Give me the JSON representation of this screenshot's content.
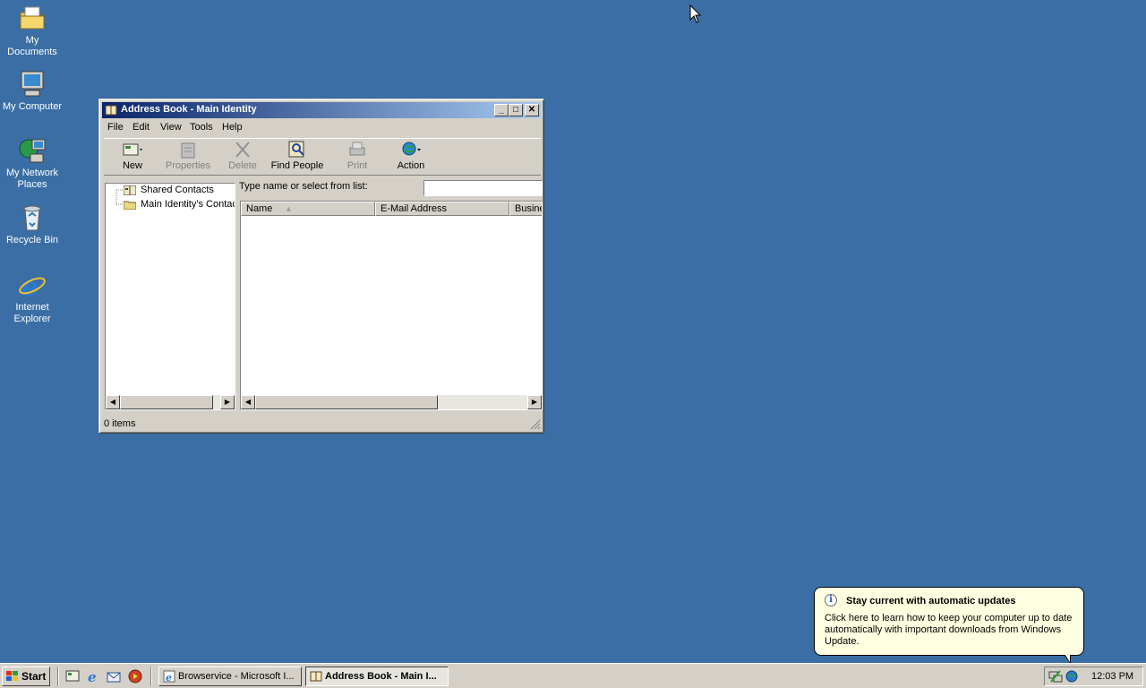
{
  "desktop": {
    "icons": [
      {
        "label": "My Documents"
      },
      {
        "label": "My Computer"
      },
      {
        "label": "My Network Places"
      },
      {
        "label": "Recycle Bin"
      },
      {
        "label": "Internet Explorer"
      }
    ]
  },
  "window": {
    "title": "Address Book - Main Identity",
    "menu": [
      "File",
      "Edit",
      "View",
      "Tools",
      "Help"
    ],
    "toolbar": {
      "new": "New",
      "properties": "Properties",
      "delete": "Delete",
      "find_people": "Find People",
      "print": "Print",
      "action": "Action"
    },
    "tree": [
      "Shared Contacts",
      "Main Identity's Contacts"
    ],
    "find_label": "Type name or select from list:",
    "find_value": "",
    "columns": [
      "Name",
      "E-Mail Address",
      "Business Phone"
    ],
    "status": "0 items"
  },
  "balloon": {
    "title": "Stay current with automatic updates",
    "text": "Click here to learn how to keep your computer up to date automatically with important downloads from Windows Update."
  },
  "taskbar": {
    "start": "Start",
    "tasks": [
      "Browservice - Microsoft I...",
      "Address Book - Main I..."
    ],
    "clock": "12:03 PM"
  },
  "colors": {
    "desktop": "#3a6ea5",
    "title_active_start": "#0a246a",
    "title_active_end": "#a6caf0",
    "face": "#d4d0c8",
    "balloon": "#ffffe1"
  }
}
